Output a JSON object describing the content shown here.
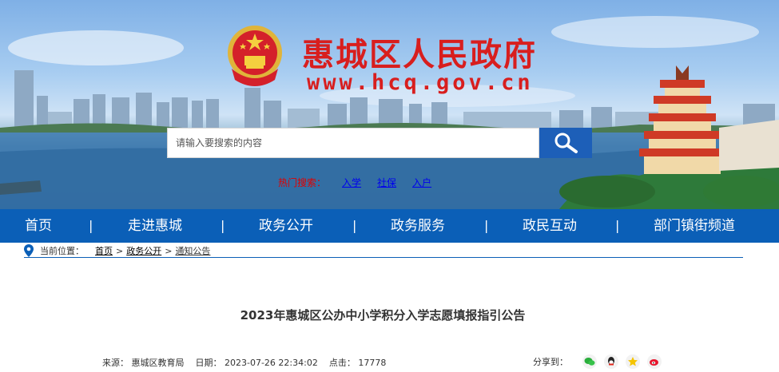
{
  "header": {
    "site_title": "惠城区人民政府",
    "site_url": "www.hcq.gov.cn"
  },
  "search": {
    "placeholder": "请输入要搜索的内容",
    "value": "",
    "hot_label": "热门搜索：",
    "hot_links": [
      "入学",
      "社保",
      "入户"
    ]
  },
  "nav": {
    "items": [
      "首页",
      "走进惠城",
      "政务公开",
      "政务服务",
      "政民互动",
      "部门镇街频道"
    ],
    "separator": "|"
  },
  "breadcrumb": {
    "label": "当前位置：",
    "items": [
      "首页",
      "政务公开",
      "通知公告"
    ],
    "separator": ">"
  },
  "article": {
    "title": "2023年惠城区公办中小学积分入学志愿填报指引公告",
    "source": "来源：  惠城区教育局",
    "date": "日期：  2023-07-26 22:34:02",
    "clicks": "点击：  17778",
    "share_label": "分享到："
  },
  "colors": {
    "nav_bg": "#0b5fb7",
    "title_red": "#d81e1e",
    "search_btn": "#1d5fb8",
    "hot_label": "#e00000"
  },
  "icons": [
    "national-emblem-icon",
    "search-icon",
    "location-pin-icon",
    "wechat-icon",
    "qq-icon",
    "qzone-icon",
    "weibo-icon"
  ]
}
